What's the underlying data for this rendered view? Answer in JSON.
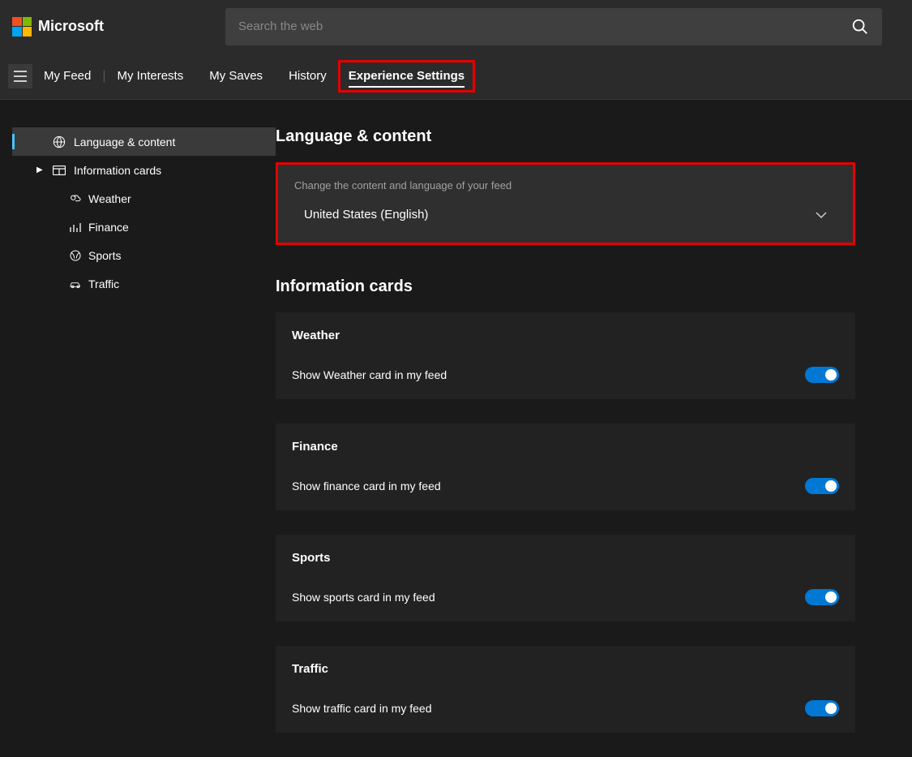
{
  "header": {
    "brand": "Microsoft",
    "search_placeholder": "Search the web"
  },
  "tabs": {
    "my_feed": "My Feed",
    "my_interests": "My Interests",
    "my_saves": "My Saves",
    "history": "History",
    "experience_settings": "Experience Settings"
  },
  "sidebar": {
    "language_content": "Language & content",
    "information_cards": "Information cards",
    "weather": "Weather",
    "finance": "Finance",
    "sports": "Sports",
    "traffic": "Traffic"
  },
  "main": {
    "language_section_title": "Language & content",
    "language_desc": "Change the content and language of your feed",
    "language_selected": "United States (English)",
    "info_cards_title": "Information cards",
    "cards": {
      "weather": {
        "title": "Weather",
        "desc": "Show Weather card in my feed",
        "on": true
      },
      "finance": {
        "title": "Finance",
        "desc": "Show finance card in my feed",
        "on": true
      },
      "sports": {
        "title": "Sports",
        "desc": "Show sports card in my feed",
        "on": true
      },
      "traffic": {
        "title": "Traffic",
        "desc": "Show traffic card in my feed",
        "on": true
      }
    }
  }
}
